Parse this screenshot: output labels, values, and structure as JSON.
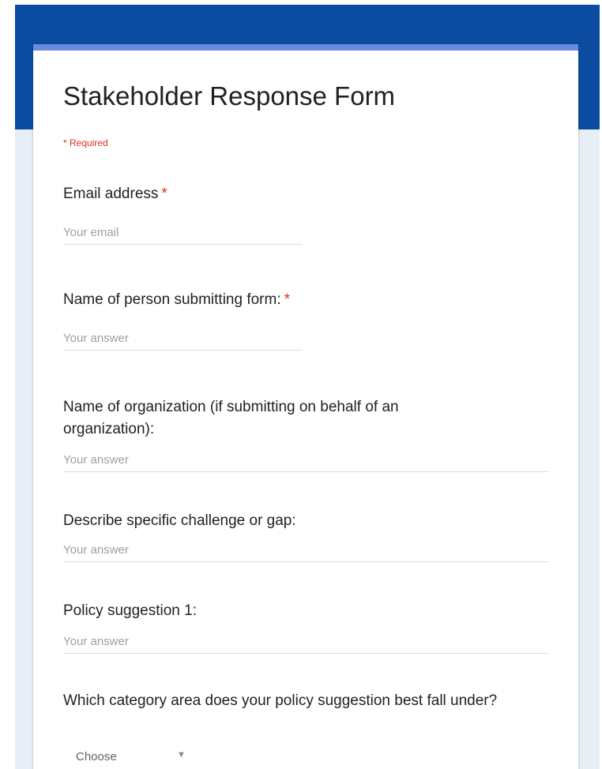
{
  "form": {
    "title": "Stakeholder Response Form",
    "required_note": "* Required",
    "required_star": "*"
  },
  "questions": [
    {
      "label": "Email address",
      "required": true,
      "placeholder": "Your email"
    },
    {
      "label": "Name of person submitting form:",
      "required": true,
      "placeholder": "Your answer"
    },
    {
      "label": "Name of organization (if submitting on behalf of an organization):",
      "required": false,
      "placeholder": "Your answer"
    },
    {
      "label": "Describe specific challenge or gap:",
      "required": false,
      "placeholder": "Your answer"
    },
    {
      "label": "Policy suggestion 1:",
      "required": false,
      "placeholder": "Your answer"
    },
    {
      "label": "Which category area does your policy suggestion best fall under?",
      "required": false,
      "select_value": "Choose"
    }
  ],
  "icons": {
    "select_caret": "dropdown-caret-icon"
  },
  "colors": {
    "header_band": "#0c4da2",
    "card_accent": "#6c8be0",
    "required_red": "#d93025",
    "page_background": "#e8eef6"
  }
}
